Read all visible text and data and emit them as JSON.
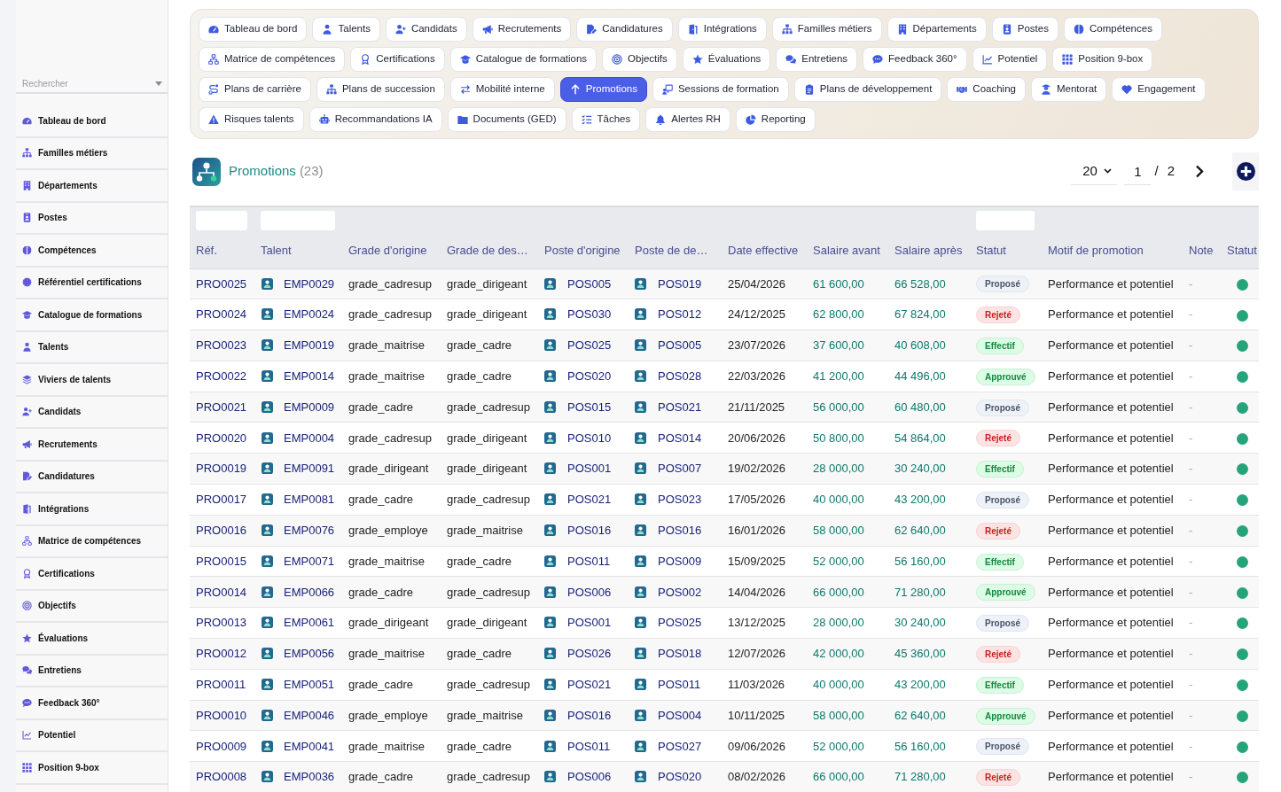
{
  "sidebar": {
    "search": {
      "placeholder": "Rechercher"
    },
    "items": [
      {
        "label": "Tableau de bord",
        "selected": false
      },
      {
        "label": "Familles métiers",
        "selected": false
      },
      {
        "label": "Départements",
        "selected": false
      },
      {
        "label": "Postes",
        "selected": false
      },
      {
        "label": "Compétences",
        "selected": false
      },
      {
        "label": "Référentiel certifications",
        "selected": false
      },
      {
        "label": "Catalogue de formations",
        "selected": false
      },
      {
        "label": "Talents",
        "selected": false
      },
      {
        "label": "Viviers de talents",
        "selected": false
      },
      {
        "label": "Candidats",
        "selected": false
      },
      {
        "label": "Recrutements",
        "selected": false
      },
      {
        "label": "Candidatures",
        "selected": false
      },
      {
        "label": "Intégrations",
        "selected": false
      },
      {
        "label": "Matrice de compétences",
        "selected": false
      },
      {
        "label": "Certifications",
        "selected": false
      },
      {
        "label": "Objectifs",
        "selected": false
      },
      {
        "label": "Évaluations",
        "selected": false
      },
      {
        "label": "Entretiens",
        "selected": false
      },
      {
        "label": "Feedback 360°",
        "selected": false
      },
      {
        "label": "Potentiel",
        "selected": false
      },
      {
        "label": "Position 9-box",
        "selected": false
      }
    ]
  },
  "tabs": [
    {
      "label": "Tableau de bord",
      "selected": false
    },
    {
      "label": "Talents",
      "selected": false
    },
    {
      "label": "Candidats",
      "selected": false
    },
    {
      "label": "Recrutements",
      "selected": false
    },
    {
      "label": "Candidatures",
      "selected": false
    },
    {
      "label": "Intégrations",
      "selected": false
    },
    {
      "label": "Familles métiers",
      "selected": false
    },
    {
      "label": "Départements",
      "selected": false
    },
    {
      "label": "Postes",
      "selected": false
    },
    {
      "label": "Compétences",
      "selected": false
    },
    {
      "label": "Matrice de compétences",
      "selected": false
    },
    {
      "label": "Certifications",
      "selected": false
    },
    {
      "label": "Catalogue de formations",
      "selected": false
    },
    {
      "label": "Objectifs",
      "selected": false
    },
    {
      "label": "Évaluations",
      "selected": false
    },
    {
      "label": "Entretiens",
      "selected": false
    },
    {
      "label": "Feedback 360°",
      "selected": false
    },
    {
      "label": "Potentiel",
      "selected": false
    },
    {
      "label": "Position 9-box",
      "selected": false
    },
    {
      "label": "Plans de carrière",
      "selected": false
    },
    {
      "label": "Plans de succession",
      "selected": false
    },
    {
      "label": "Mobilité interne",
      "selected": false
    },
    {
      "label": "Promotions",
      "selected": true
    },
    {
      "label": "Sessions de formation",
      "selected": false
    },
    {
      "label": "Plans de développement",
      "selected": false
    },
    {
      "label": "Coaching",
      "selected": false
    },
    {
      "label": "Mentorat",
      "selected": false
    },
    {
      "label": "Engagement",
      "selected": false
    },
    {
      "label": "Risques talents",
      "selected": false
    },
    {
      "label": "Recommandations IA",
      "selected": false
    },
    {
      "label": "Documents (GED)",
      "selected": false
    },
    {
      "label": "Tâches",
      "selected": false
    },
    {
      "label": "Alertes RH",
      "selected": false
    },
    {
      "label": "Reporting",
      "selected": false
    }
  ],
  "header": {
    "title": "Promotions",
    "count": "(23)"
  },
  "pager": {
    "page_size": "20",
    "page": "1",
    "separator": "/",
    "page_count": "2"
  },
  "table": {
    "columns": [
      {
        "label": "Réf.",
        "filter": true
      },
      {
        "label": "Talent",
        "filter": true
      },
      {
        "label": "Grade d'origine",
        "filter": false
      },
      {
        "label": "Grade de des…",
        "filter": false
      },
      {
        "label": "Poste d'origine",
        "filter": false
      },
      {
        "label": "Poste de de…",
        "filter": false
      },
      {
        "label": "Date effective",
        "filter": false
      },
      {
        "label": "Salaire avant",
        "filter": false
      },
      {
        "label": "Salaire après",
        "filter": false
      },
      {
        "label": "Statut",
        "filter": true
      },
      {
        "label": "Motif de promotion",
        "filter": false
      },
      {
        "label": "Note",
        "filter": false
      },
      {
        "label": "Statut",
        "filter": false
      }
    ],
    "rows": [
      {
        "ref": "PRO0025",
        "talent": "EMP0029",
        "grade_from": "grade_cadresup",
        "grade_to": "grade_dirigeant",
        "post_from": "POS005",
        "post_to": "POS019",
        "date": "25/04/2026",
        "salary_before": "61 600,00",
        "salary_after": "66 528,00",
        "status": {
          "label": "Proposé",
          "kind": "proposed"
        },
        "reason": "Performance et potentiel",
        "note": "-",
        "status_dot": {
          "color": "#25a47b"
        }
      },
      {
        "ref": "PRO0024",
        "talent": "EMP0024",
        "grade_from": "grade_cadresup",
        "grade_to": "grade_dirigeant",
        "post_from": "POS030",
        "post_to": "POS012",
        "date": "24/12/2025",
        "salary_before": "62 800,00",
        "salary_after": "67 824,00",
        "status": {
          "label": "Rejeté",
          "kind": "rejected"
        },
        "reason": "Performance et potentiel",
        "note": "-",
        "status_dot": {
          "color": "#25a47b"
        }
      },
      {
        "ref": "PRO0023",
        "talent": "EMP0019",
        "grade_from": "grade_maitrise",
        "grade_to": "grade_cadre",
        "post_from": "POS025",
        "post_to": "POS005",
        "date": "23/07/2026",
        "salary_before": "37 600,00",
        "salary_after": "40 608,00",
        "status": {
          "label": "Effectif",
          "kind": "effective"
        },
        "reason": "Performance et potentiel",
        "note": "-",
        "status_dot": {
          "color": "#25a47b"
        }
      },
      {
        "ref": "PRO0022",
        "talent": "EMP0014",
        "grade_from": "grade_maitrise",
        "grade_to": "grade_cadre",
        "post_from": "POS020",
        "post_to": "POS028",
        "date": "22/03/2026",
        "salary_before": "41 200,00",
        "salary_after": "44 496,00",
        "status": {
          "label": "Approuvé",
          "kind": "approved"
        },
        "reason": "Performance et potentiel",
        "note": "-",
        "status_dot": {
          "color": "#25a47b"
        }
      },
      {
        "ref": "PRO0021",
        "talent": "EMP0009",
        "grade_from": "grade_cadre",
        "grade_to": "grade_cadresup",
        "post_from": "POS015",
        "post_to": "POS021",
        "date": "21/11/2025",
        "salary_before": "56 000,00",
        "salary_after": "60 480,00",
        "status": {
          "label": "Proposé",
          "kind": "proposed"
        },
        "reason": "Performance et potentiel",
        "note": "-",
        "status_dot": {
          "color": "#25a47b"
        }
      },
      {
        "ref": "PRO0020",
        "talent": "EMP0004",
        "grade_from": "grade_cadresup",
        "grade_to": "grade_dirigeant",
        "post_from": "POS010",
        "post_to": "POS014",
        "date": "20/06/2026",
        "salary_before": "50 800,00",
        "salary_after": "54 864,00",
        "status": {
          "label": "Rejeté",
          "kind": "rejected"
        },
        "reason": "Performance et potentiel",
        "note": "-",
        "status_dot": {
          "color": "#25a47b"
        }
      },
      {
        "ref": "PRO0019",
        "talent": "EMP0091",
        "grade_from": "grade_dirigeant",
        "grade_to": "grade_dirigeant",
        "post_from": "POS001",
        "post_to": "POS007",
        "date": "19/02/2026",
        "salary_before": "28 000,00",
        "salary_after": "30 240,00",
        "status": {
          "label": "Effectif",
          "kind": "effective"
        },
        "reason": "Performance et potentiel",
        "note": "-",
        "status_dot": {
          "color": "#25a47b"
        }
      },
      {
        "ref": "PRO0017",
        "talent": "EMP0081",
        "grade_from": "grade_cadre",
        "grade_to": "grade_cadresup",
        "post_from": "POS021",
        "post_to": "POS023",
        "date": "17/05/2026",
        "salary_before": "40 000,00",
        "salary_after": "43 200,00",
        "status": {
          "label": "Proposé",
          "kind": "proposed"
        },
        "reason": "Performance et potentiel",
        "note": "-",
        "status_dot": {
          "color": "#25a47b"
        }
      },
      {
        "ref": "PRO0016",
        "talent": "EMP0076",
        "grade_from": "grade_employe",
        "grade_to": "grade_maitrise",
        "post_from": "POS016",
        "post_to": "POS016",
        "date": "16/01/2026",
        "salary_before": "58 000,00",
        "salary_after": "62 640,00",
        "status": {
          "label": "Rejeté",
          "kind": "rejected"
        },
        "reason": "Performance et potentiel",
        "note": "-",
        "status_dot": {
          "color": "#25a47b"
        }
      },
      {
        "ref": "PRO0015",
        "talent": "EMP0071",
        "grade_from": "grade_maitrise",
        "grade_to": "grade_cadre",
        "post_from": "POS011",
        "post_to": "POS009",
        "date": "15/09/2025",
        "salary_before": "52 000,00",
        "salary_after": "56 160,00",
        "status": {
          "label": "Effectif",
          "kind": "effective"
        },
        "reason": "Performance et potentiel",
        "note": "-",
        "status_dot": {
          "color": "#25a47b"
        }
      },
      {
        "ref": "PRO0014",
        "talent": "EMP0066",
        "grade_from": "grade_cadre",
        "grade_to": "grade_cadresup",
        "post_from": "POS006",
        "post_to": "POS002",
        "date": "14/04/2026",
        "salary_before": "66 000,00",
        "salary_after": "71 280,00",
        "status": {
          "label": "Approuvé",
          "kind": "approved"
        },
        "reason": "Performance et potentiel",
        "note": "-",
        "status_dot": {
          "color": "#25a47b"
        }
      },
      {
        "ref": "PRO0013",
        "talent": "EMP0061",
        "grade_from": "grade_dirigeant",
        "grade_to": "grade_dirigeant",
        "post_from": "POS001",
        "post_to": "POS025",
        "date": "13/12/2025",
        "salary_before": "28 000,00",
        "salary_after": "30 240,00",
        "status": {
          "label": "Proposé",
          "kind": "proposed"
        },
        "reason": "Performance et potentiel",
        "note": "-",
        "status_dot": {
          "color": "#25a47b"
        }
      },
      {
        "ref": "PRO0012",
        "talent": "EMP0056",
        "grade_from": "grade_maitrise",
        "grade_to": "grade_cadre",
        "post_from": "POS026",
        "post_to": "POS018",
        "date": "12/07/2026",
        "salary_before": "42 000,00",
        "salary_after": "45 360,00",
        "status": {
          "label": "Rejeté",
          "kind": "rejected"
        },
        "reason": "Performance et potentiel",
        "note": "-",
        "status_dot": {
          "color": "#25a47b"
        }
      },
      {
        "ref": "PRO0011",
        "talent": "EMP0051",
        "grade_from": "grade_cadre",
        "grade_to": "grade_cadresup",
        "post_from": "POS021",
        "post_to": "POS011",
        "date": "11/03/2026",
        "salary_before": "40 000,00",
        "salary_after": "43 200,00",
        "status": {
          "label": "Effectif",
          "kind": "effective"
        },
        "reason": "Performance et potentiel",
        "note": "-",
        "status_dot": {
          "color": "#25a47b"
        }
      },
      {
        "ref": "PRO0010",
        "talent": "EMP0046",
        "grade_from": "grade_employe",
        "grade_to": "grade_maitrise",
        "post_from": "POS016",
        "post_to": "POS004",
        "date": "10/11/2025",
        "salary_before": "58 000,00",
        "salary_after": "62 640,00",
        "status": {
          "label": "Approuvé",
          "kind": "approved"
        },
        "reason": "Performance et potentiel",
        "note": "-",
        "status_dot": {
          "color": "#25a47b"
        }
      },
      {
        "ref": "PRO0009",
        "talent": "EMP0041",
        "grade_from": "grade_maitrise",
        "grade_to": "grade_cadre",
        "post_from": "POS011",
        "post_to": "POS027",
        "date": "09/06/2026",
        "salary_before": "52 000,00",
        "salary_after": "56 160,00",
        "status": {
          "label": "Proposé",
          "kind": "proposed"
        },
        "reason": "Performance et potentiel",
        "note": "-",
        "status_dot": {
          "color": "#25a47b"
        }
      },
      {
        "ref": "PRO0008",
        "talent": "EMP0036",
        "grade_from": "grade_cadre",
        "grade_to": "grade_cadresup",
        "post_from": "POS006",
        "post_to": "POS020",
        "date": "08/02/2026",
        "salary_before": "66 000,00",
        "salary_after": "71 280,00",
        "status": {
          "label": "Rejeté",
          "kind": "rejected"
        },
        "reason": "Performance et potentiel",
        "note": "-",
        "status_dot": {
          "color": "#25a47b"
        }
      }
    ]
  }
}
